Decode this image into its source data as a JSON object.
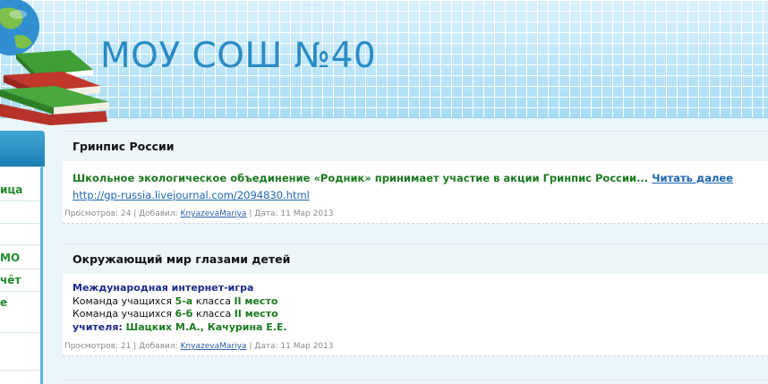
{
  "header": {
    "site_title": "МОУ СОШ №40"
  },
  "sidebar": {
    "items": [
      "ица",
      "",
      "МО",
      "чёт",
      "е"
    ]
  },
  "entries": [
    {
      "title": "Гринпис России",
      "text": "Школьное экологическое объединение «Родник» принимает участие в акции Гринпис России... ",
      "read_more": "Читать далее",
      "url": "http://gp-russia.livejournal.com/2094830.html",
      "meta": {
        "views_label": "Просмотров: 24",
        "added_label": "Добавил:",
        "author": "KnyazevaMariya",
        "date_label": "Дата: 11 Мар 2013",
        "sep": "|"
      }
    },
    {
      "title": "Окружающий мир глазами детей",
      "line1": "Международная интернет-игра",
      "line2_pre": "Команда учащихся ",
      "line2_class": "5-а",
      "line2_mid": " класса ",
      "line2_place": "II место",
      "line3_pre": "Команда учащихся ",
      "line3_class": "6-б",
      "line3_mid": " класса ",
      "line3_place": "II место",
      "line4_label": "учителя:",
      "line4_names": "Шацких М.А., Качурина Е.Е.",
      "meta": {
        "views_label": "Просмотров: 21",
        "added_label": "Добавил:",
        "author": "KnyazevaMariya",
        "date_label": "Дата: 11 Мар 2013",
        "sep": "|"
      }
    }
  ]
}
